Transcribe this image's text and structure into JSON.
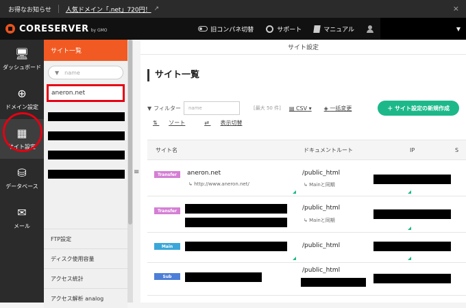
{
  "notice": {
    "label": "お得なお知らせ",
    "link": "人気ドメイン「.net」720円！",
    "close": "×"
  },
  "header": {
    "brand": "CORESERVER",
    "brand_sub": "by GMO",
    "old_panel": "旧コンパネ切替",
    "support": "サポート",
    "manual": "マニュアル",
    "user_dropdown": "▼"
  },
  "rail": [
    {
      "label": "ダッシュボード",
      "icon": "🖥"
    },
    {
      "label": "ドメイン設定",
      "icon": "⊕"
    },
    {
      "label": "サイト設定",
      "icon": "▦"
    },
    {
      "label": "データベース",
      "icon": "⛁"
    },
    {
      "label": "メール",
      "icon": "✉"
    }
  ],
  "sidebar": {
    "title": "サイト一覧",
    "filter_placeholder": "name",
    "selected_site": "aneron.net",
    "menu": [
      "FTP設定",
      "ディスク使用容量",
      "アクセス統計",
      "アクセス解析 analog"
    ]
  },
  "main": {
    "topbar_title": "サイト設定",
    "page_title": "サイト一覧",
    "filter_label": "フィルター",
    "filter_placeholder": "name",
    "max_count": "[最大 50 件]",
    "csv_label": "CSV",
    "bulk_label": "一括変更",
    "new_button": "＋ サイト設定の新規作成",
    "sort_label": "ソート",
    "display_label": "表示切替",
    "columns": [
      "サイト名",
      "ドキュメントルート",
      "IP",
      "S"
    ],
    "rows": [
      {
        "type": "Transfer",
        "name": "aneron.net",
        "sub": "http://www.aneron.net/",
        "docroot": "/public_html",
        "sync": "Mainと同期"
      },
      {
        "type": "Transfer",
        "name": "",
        "sub": "",
        "docroot": "/public_html",
        "sync": "Mainと同期"
      },
      {
        "type": "Main",
        "name": "",
        "sub": "",
        "docroot": "/public_html",
        "sync": ""
      },
      {
        "type": "Sub",
        "name": "",
        "sub": "",
        "docroot": "/public_html",
        "sync": ""
      }
    ]
  },
  "colors": {
    "accent": "#f15a22",
    "green": "#1db88a",
    "highlight": "#e60012"
  }
}
